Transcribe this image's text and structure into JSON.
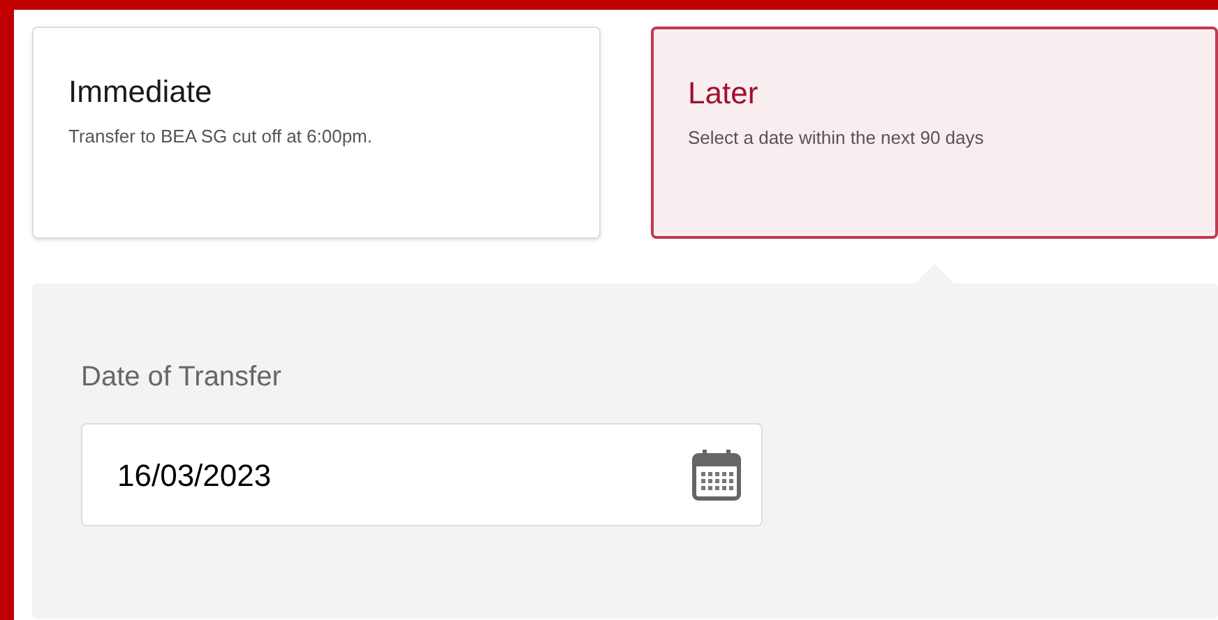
{
  "options": [
    {
      "title": "Immediate",
      "description": "Transfer to BEA SG cut off at 6:00pm.",
      "selected": false
    },
    {
      "title": "Later",
      "description": "Select a date within the next 90 days",
      "selected": true
    }
  ],
  "date_field": {
    "label": "Date of Transfer",
    "value": "16/03/2023"
  }
}
